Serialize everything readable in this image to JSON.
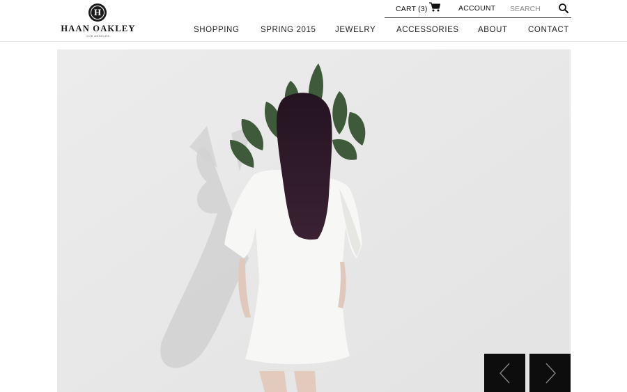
{
  "brand": {
    "name": "HAAN OAKLEY",
    "monogram": "H",
    "location": "LOS ANGELES"
  },
  "utility": {
    "cart_label": "CART (3)",
    "account_label": "ACCOUNT",
    "search_placeholder": "SEARCH"
  },
  "nav": {
    "items": [
      "SHOPPING",
      "SPRING 2015",
      "JEWELRY",
      "ACCESSORIES",
      "ABOUT",
      "CONTACT"
    ]
  },
  "hero": {
    "icons": {
      "prev": "chevron-left-icon",
      "next": "chevron-right-icon"
    }
  },
  "colors": {
    "text": "#111111",
    "hero_background": "#e9e9e9",
    "slider_button": "#0d0d0d",
    "plant": "#3f5a3a",
    "hair": "#2a1622"
  }
}
